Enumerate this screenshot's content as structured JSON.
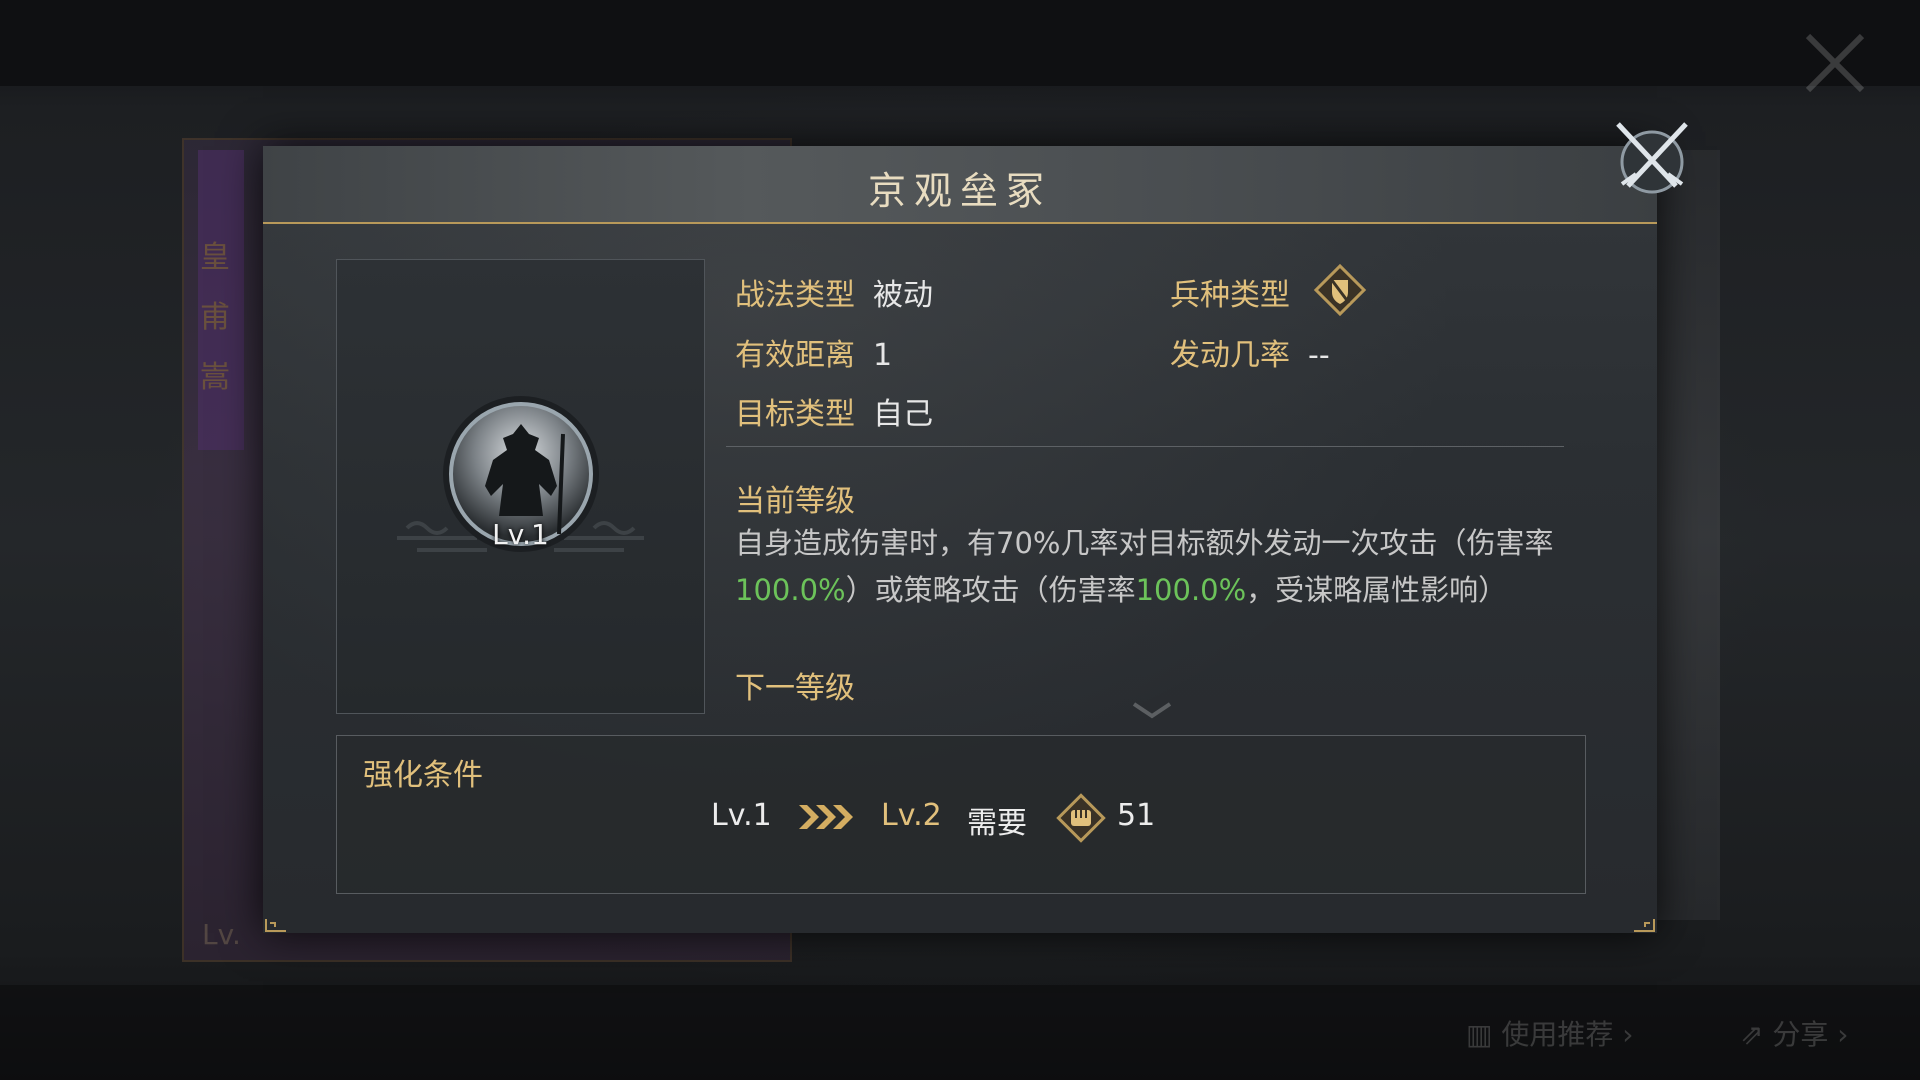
{
  "background": {
    "left_card_text": [
      "皇",
      "甫",
      "嵩"
    ],
    "left_card_level": "Lv.",
    "bottom_buttons": [
      "使用推荐",
      "分享"
    ]
  },
  "dialog": {
    "title": "京观垒冢",
    "close_icon": "crossed-swords-close-icon",
    "portrait": {
      "level": "Lv.1",
      "icon": "warrior-silhouette-icon"
    },
    "info": {
      "tactic_type_label": "战法类型",
      "tactic_type_value": "被动",
      "troop_type_label": "兵种类型",
      "troop_type_icon": "troop-type-shield-icon",
      "range_label": "有效距离",
      "range_value": "1",
      "chance_label": "发动几率",
      "chance_value": "--",
      "target_label": "目标类型",
      "target_value": "自己"
    },
    "current_level": {
      "title": "当前等级",
      "desc_1": "自身造成伤害时，有70%几率对目标额外发动一次攻击（伤害率",
      "desc_2": "100.0%",
      "desc_3": "）或策略攻击（伤害率",
      "desc_4": "100.0%",
      "desc_5": "，受谋略属性影响）"
    },
    "next_level": {
      "title": "下一等级"
    },
    "upgrade": {
      "title": "强化条件",
      "from_level": "Lv.1",
      "arrow_icon": "triple-chevron-right-icon",
      "to_level": "Lv.2",
      "need_label": "需要",
      "resource_icon": "fist-token-icon",
      "amount": "51"
    },
    "colors": {
      "gold": "#e1c07c",
      "highlight_green": "#6cc35a",
      "text": "#e7e7e7"
    }
  }
}
